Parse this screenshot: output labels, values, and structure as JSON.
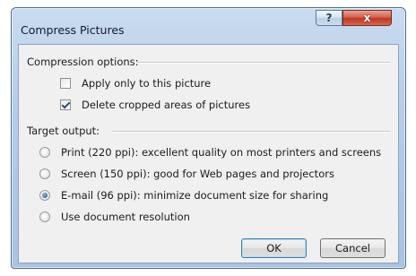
{
  "window": {
    "title": "Compress Pictures",
    "help_label": "?",
    "close_label": "x"
  },
  "compression": {
    "heading": "Compression options:",
    "options": [
      {
        "label": "Apply only to this picture",
        "checked": false
      },
      {
        "label": "Delete cropped areas of pictures",
        "checked": true
      }
    ]
  },
  "target": {
    "heading": "Target output:",
    "options": [
      {
        "label": "Print (220 ppi): excellent quality on most printers and screens",
        "selected": false
      },
      {
        "label": "Screen (150 ppi): good for Web pages and projectors",
        "selected": false
      },
      {
        "label": "E-mail (96 ppi): minimize document size for sharing",
        "selected": true
      },
      {
        "label": "Use document resolution",
        "selected": false
      }
    ]
  },
  "buttons": {
    "ok_label": "OK",
    "cancel_label": "Cancel"
  },
  "colors": {
    "title_bar": "#b5cde8",
    "close_button": "#c03822",
    "dialog_background": "#f0f0f0"
  }
}
